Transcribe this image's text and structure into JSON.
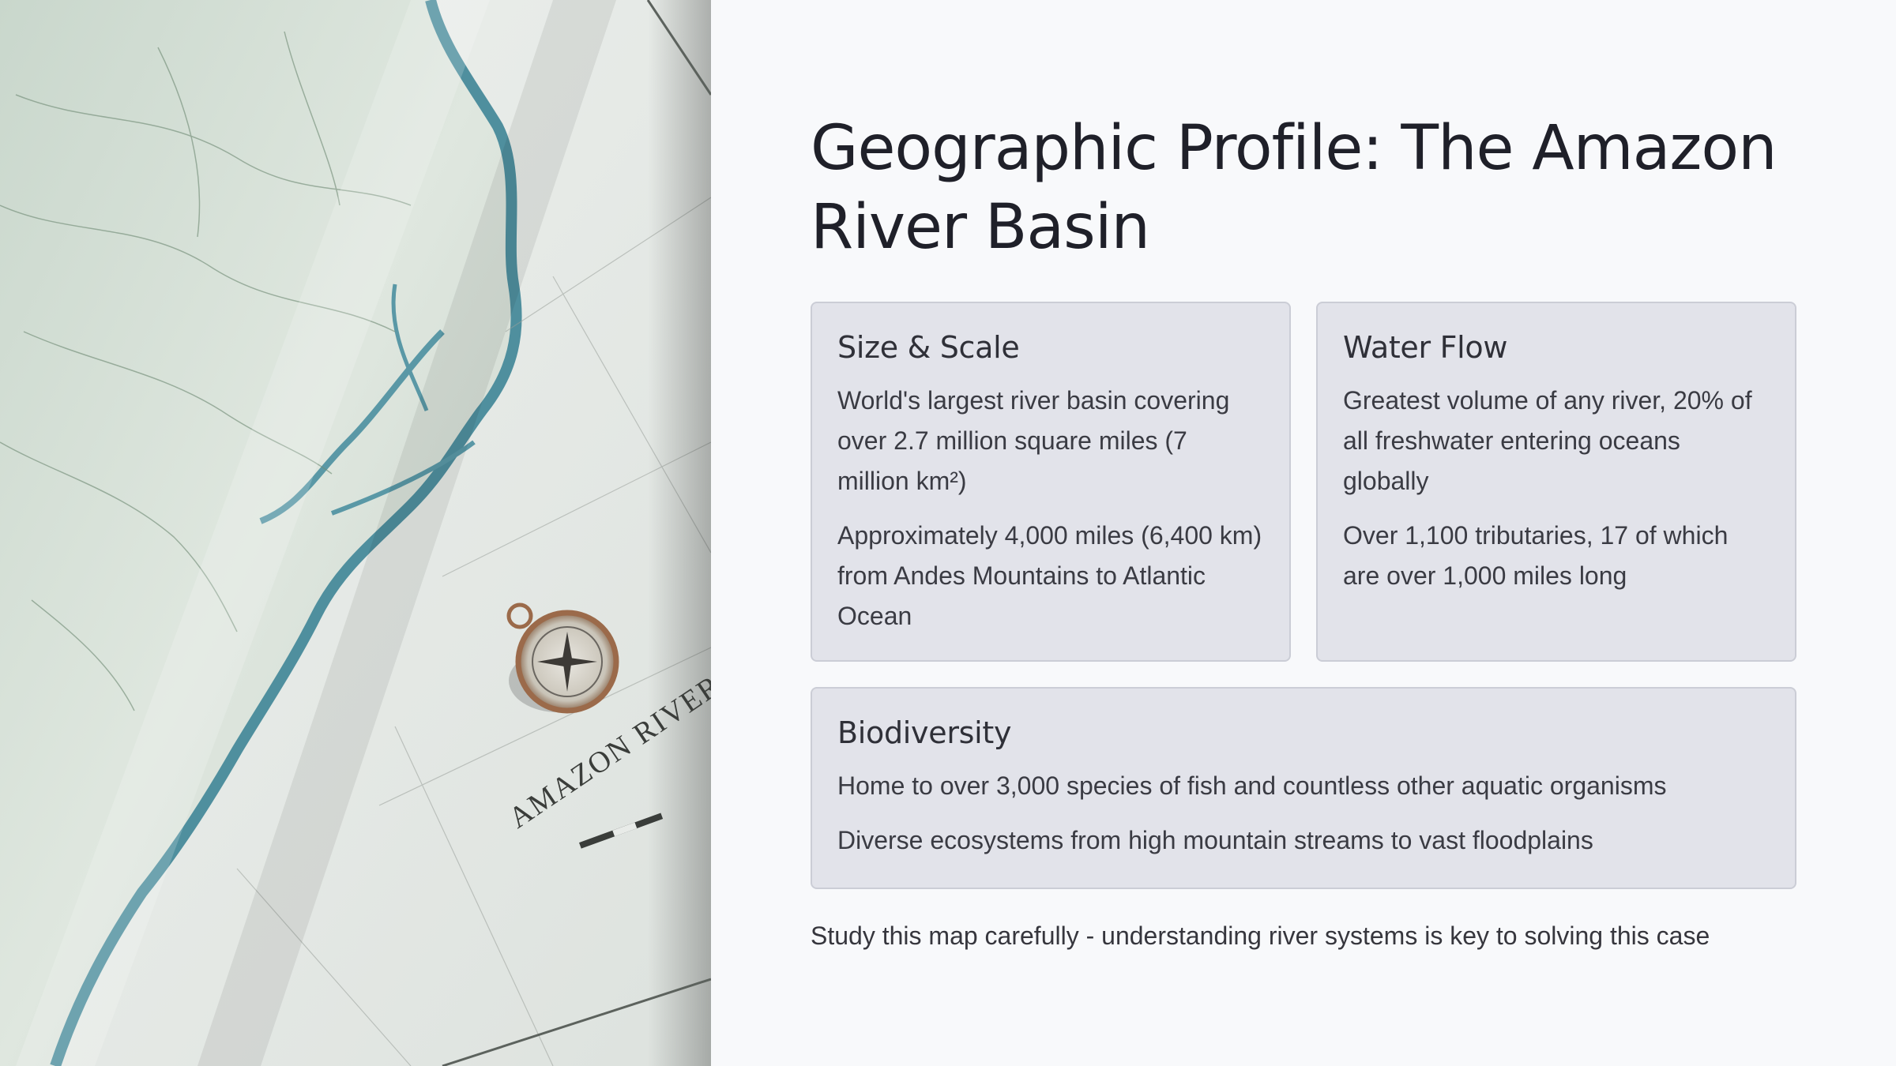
{
  "slide": {
    "title": "Geographic Profile: The Amazon River Basin",
    "footer": "Study this map carefully - understanding river systems is key to solving this case"
  },
  "image": {
    "description_icon": "map-photo",
    "map_label": "AMAZON RIVER"
  },
  "cards": {
    "size": {
      "title": "Size & Scale",
      "points": [
        "World's largest river basin covering over 2.7 million square miles (7 million km²)",
        "Approximately 4,000 miles (6,400 km) from Andes Mountains to Atlantic Ocean"
      ]
    },
    "flow": {
      "title": "Water Flow",
      "points": [
        "Greatest volume of any river, 20% of all freshwater entering oceans globally",
        "Over 1,100 tributaries, 17 of which are over 1,000 miles long"
      ]
    },
    "biodiversity": {
      "title": "Biodiversity",
      "points": [
        "Home to over 3,000 species of fish and countless other aquatic organisms",
        "Diverse ecosystems from high mountain streams to vast floodplains"
      ]
    }
  },
  "colors": {
    "background": "#f8f9fb",
    "card_bg": "#e2e3ea",
    "card_border": "#cbcdd6",
    "river": "#4f8f9e",
    "land": "#dfe7df"
  }
}
